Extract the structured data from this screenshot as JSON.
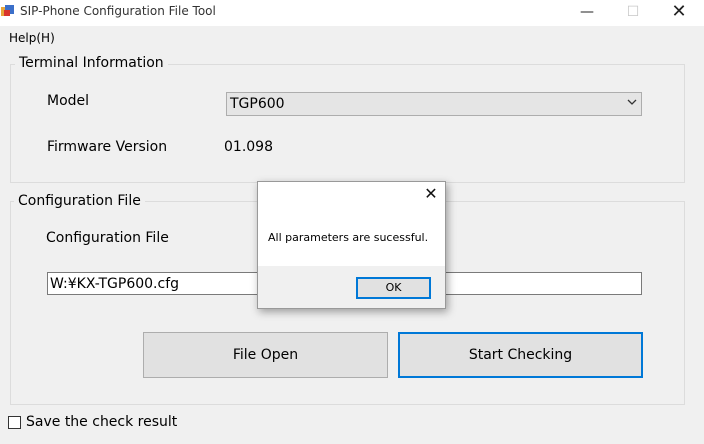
{
  "window": {
    "title": "SIP-Phone Configuration File Tool"
  },
  "menu": {
    "help": "Help(H)"
  },
  "terminal": {
    "group_title": "Terminal Information",
    "model_label": "Model",
    "model_value": "TGP600",
    "firmware_label": "Firmware Version",
    "firmware_value": "01.098"
  },
  "config": {
    "group_title": "Configuration File",
    "file_label": "Configuration File",
    "file_value": "W:¥KX-TGP600.cfg",
    "file_open_button": "File Open",
    "start_checking_button": "Start Checking"
  },
  "save_check_label": "Save the check result",
  "save_check_checked": false,
  "dialog": {
    "message": "All parameters are sucessful.",
    "ok_button": "OK"
  },
  "icons": {
    "app": "app-icon",
    "minimize": "minimize-icon",
    "maximize": "maximize-icon",
    "close": "close-icon",
    "dropdown": "chevron-down-icon"
  },
  "colors": {
    "focus_accent": "#0078d7"
  }
}
